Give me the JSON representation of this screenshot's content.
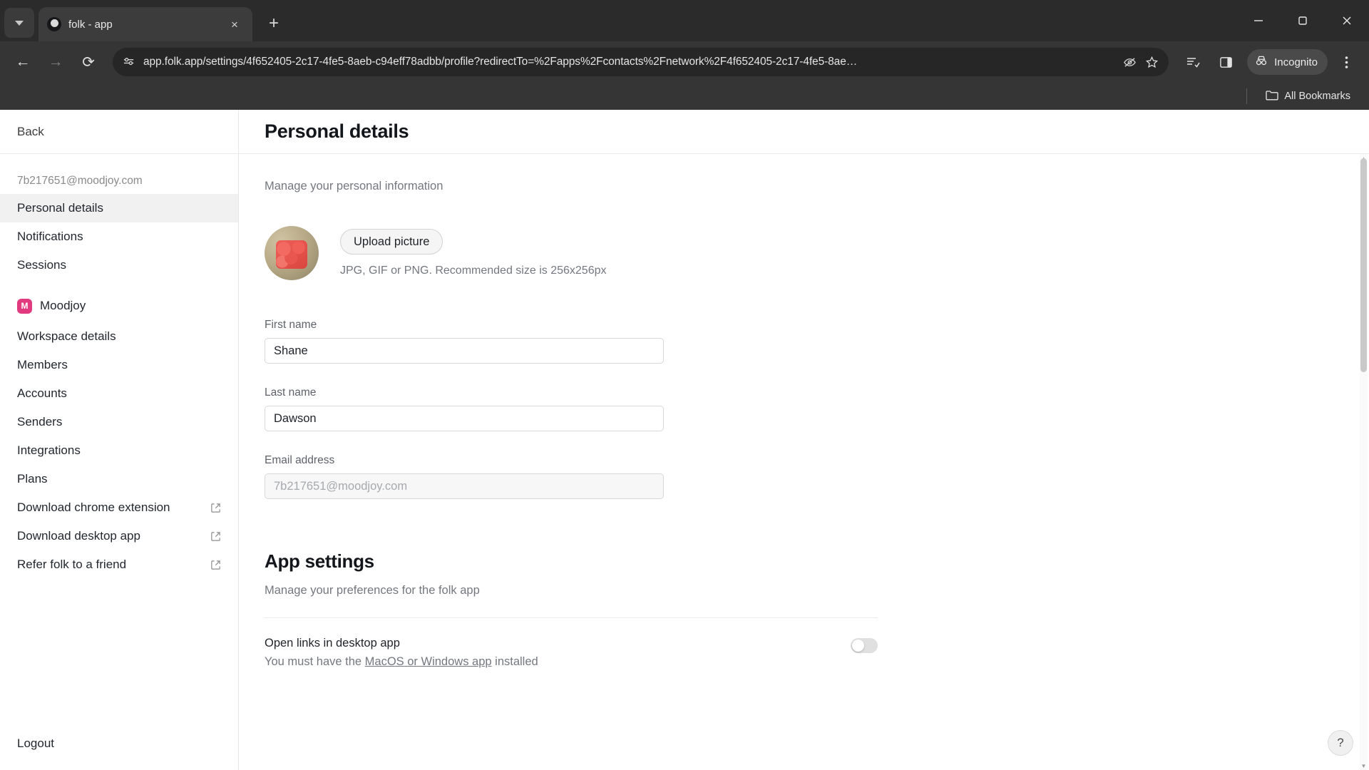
{
  "browser": {
    "tab": {
      "title": "folk - app",
      "favicon": "folk-circle-icon",
      "close_label": "×"
    },
    "new_tab_label": "+",
    "tab_list_icon": "chevron-down-icon",
    "window_controls": {
      "minimize": "—",
      "maximize": "❐",
      "close": "✕"
    },
    "nav": {
      "back": "←",
      "forward": "→",
      "reload": "⟳"
    },
    "omnibox": {
      "site_icon": "page-settings-icon",
      "url": "app.folk.app/settings/4f652405-2c17-4fe5-8aeb-c94eff78adbb/profile?redirectTo=%2Fapps%2Fcontacts%2Fnetwork%2F4f652405-2c17-4fe5-8ae…"
    },
    "toolbar_icons": [
      "eye-off-icon",
      "star-icon",
      "reading-list-icon",
      "side-panel-icon"
    ],
    "incognito": {
      "label": "Incognito",
      "icon": "incognito-icon"
    },
    "menu_icon": "three-dot-menu-icon",
    "bookmarks": {
      "folder_icon": "folder-icon",
      "label": "All Bookmarks"
    }
  },
  "sidebar": {
    "back": "Back",
    "account_email": "7b217651@moodjoy.com",
    "account_items": [
      {
        "label": "Personal details",
        "active": true
      },
      {
        "label": "Notifications",
        "active": false
      },
      {
        "label": "Sessions",
        "active": false
      }
    ],
    "workspace": {
      "badge": "M",
      "name": "Moodjoy"
    },
    "workspace_items": [
      {
        "label": "Workspace details",
        "external": false
      },
      {
        "label": "Members",
        "external": false
      },
      {
        "label": "Accounts",
        "external": false
      },
      {
        "label": "Senders",
        "external": false
      },
      {
        "label": "Integrations",
        "external": false
      },
      {
        "label": "Plans",
        "external": false
      },
      {
        "label": "Download chrome extension",
        "external": true
      },
      {
        "label": "Download desktop app",
        "external": true
      },
      {
        "label": "Refer folk to a friend",
        "external": true
      }
    ],
    "logout": "Logout"
  },
  "main": {
    "title": "Personal details",
    "subtitle": "Manage your personal information",
    "avatar": {
      "alt": "profile-picture"
    },
    "upload_button": "Upload picture",
    "upload_hint": "JPG, GIF or PNG. Recommended size is 256x256px",
    "fields": [
      {
        "label": "First name",
        "value": "Shane",
        "disabled": false
      },
      {
        "label": "Last name",
        "value": "Dawson",
        "disabled": false
      },
      {
        "label": "Email address",
        "value": "7b217651@moodjoy.com",
        "disabled": true
      }
    ],
    "app_settings": {
      "title": "App settings",
      "subtitle": "Manage your preferences for the folk app",
      "rows": [
        {
          "name": "Open links in desktop app",
          "desc_before": "You must have the ",
          "desc_link": "MacOS or Windows app",
          "desc_after": " installed",
          "toggle_on": false
        }
      ]
    },
    "help_label": "?"
  },
  "colors": {
    "accent": "#e23a7e",
    "chrome_bg": "#353535",
    "tab_bg": "#3c3c3c",
    "active_nav": "#f1f1f1"
  }
}
